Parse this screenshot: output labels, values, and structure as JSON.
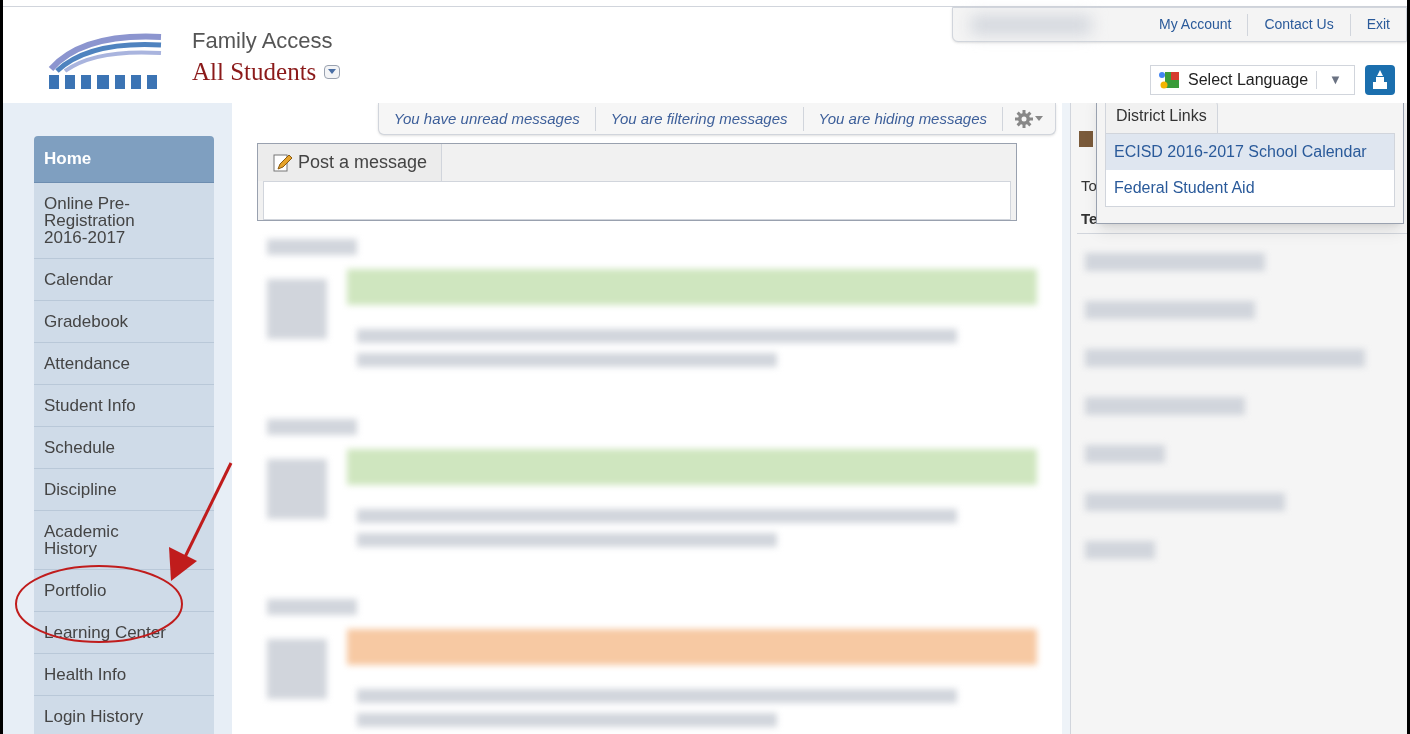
{
  "header": {
    "product": "Family Access",
    "student_selector": "All Students"
  },
  "top_links": [
    "My Account",
    "Contact Us",
    "Exit"
  ],
  "language_selector": {
    "label": "Select Language",
    "arrow": "▼"
  },
  "sidebar": {
    "items": [
      {
        "label": "Home",
        "selected": true
      },
      {
        "label": "Online Pre-Registration 2016-2017",
        "selected": false
      },
      {
        "label": "Calendar",
        "selected": false
      },
      {
        "label": "Gradebook",
        "selected": false
      },
      {
        "label": "Attendance",
        "selected": false
      },
      {
        "label": "Student Info",
        "selected": false
      },
      {
        "label": "Schedule",
        "selected": false
      },
      {
        "label": "Discipline",
        "selected": false
      },
      {
        "label": "Academic History",
        "selected": false
      },
      {
        "label": "Portfolio",
        "selected": false
      },
      {
        "label": "Learning Center",
        "selected": false
      },
      {
        "label": "Health Info",
        "selected": false
      },
      {
        "label": "Login History",
        "selected": false
      }
    ]
  },
  "message_filters": [
    "You have unread messages",
    "You are filtering messages",
    "You are hiding messages"
  ],
  "post_message": {
    "label": "Post a message"
  },
  "message_cards": [
    {
      "color": "#cfe6bf"
    },
    {
      "color": "#cfe6bf"
    },
    {
      "color": "#f7c9a3"
    }
  ],
  "right_panel": {
    "texts": [
      "To",
      "Te"
    ]
  },
  "district_links": {
    "title": "District Links",
    "items": [
      {
        "label": "ECISD 2016-2017 School Calendar",
        "selected": true
      },
      {
        "label": "Federal Student Aid",
        "selected": false
      }
    ]
  }
}
